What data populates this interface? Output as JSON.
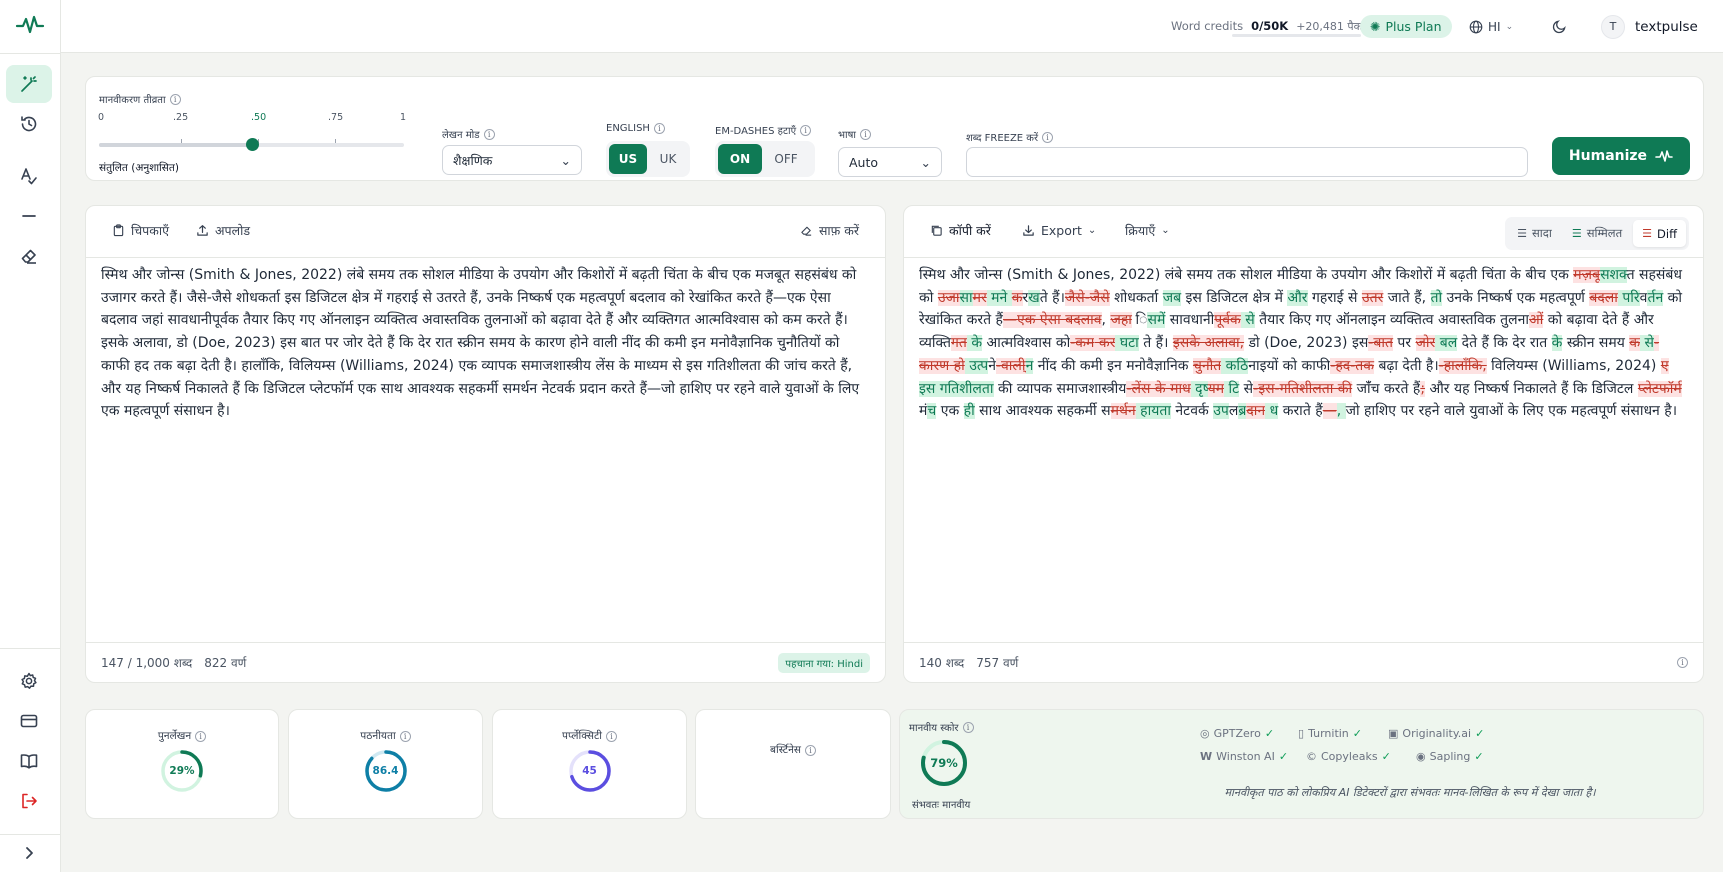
{
  "topbar": {
    "credits_label": "Word credits",
    "credits_value": "0/50K",
    "credits_bonus": "+20,481 पैक",
    "plan": "Plus Plan",
    "lang": "HI",
    "username": "textpulse",
    "avatar_initial": "T"
  },
  "settings": {
    "intensity_label": "मानवीकरण तीव्रता",
    "ticks": [
      "0",
      ".25",
      ".50",
      ".75",
      "1"
    ],
    "intensity_value": 0.5,
    "intensity_mode": "संतुलित (अनुशासित)",
    "mode_label": "लेखन मोड",
    "mode_value": "शैक्षणिक",
    "english_label": "ENGLISH",
    "english_options": [
      "US",
      "UK"
    ],
    "emdash_label": "EM-DASHES हटाएँ",
    "emdash_options": [
      "ON",
      "OFF"
    ],
    "language_label": "भाषा",
    "language_value": "Auto",
    "freeze_label": "शब्द FREEZE करें",
    "freeze_value": "",
    "humanize": "Humanize"
  },
  "input_panel": {
    "paste": "चिपकाएँ",
    "upload": "अपलोड",
    "clear": "साफ़ करें",
    "text": "स्मिथ और जोन्स (Smith & Jones, 2022) लंबे समय तक सोशल मीडिया के उपयोग और किशोरों में बढ़ती चिंता के बीच एक मजबूत सहसंबंध को उजागर करते हैं। जैसे-जैसे शोधकर्ता इस डिजिटल क्षेत्र में गहराई से उतरते हैं, उनके निष्कर्ष एक महत्वपूर्ण बदलाव को रेखांकित करते हैं—एक ऐसा बदलाव जहां सावधानीपूर्वक तैयार किए गए ऑनलाइन व्यक्तित्व अवास्तविक तुलनाओं को बढ़ावा देते हैं और व्यक्तिगत आत्मविश्वास को कम करते हैं। इसके अलावा, डो (Doe, 2023) इस बात पर जोर देते हैं कि देर रात स्क्रीन समय के कारण होने वाली नींद की कमी इन मनोवैज्ञानिक चुनौतियों को काफी हद तक बढ़ा देती है। हालाँकि, विलियम्स (Williams, 2024) एक व्यापक समाजशास्त्रीय लेंस के माध्यम से इस गतिशीलता की जांच करते हैं, और यह निष्कर्ष निकालते हैं कि डिजिटल प्लेटफॉर्म एक साथ आवश्यक सहकर्मी समर्थन नेटवर्क प्रदान करते हैं—जो हाशिए पर रहने वाले युवाओं के लिए एक महत्वपूर्ण संसाधन है।",
    "word_count": "147 / 1,000 शब्द",
    "char_count": "822 वर्ण",
    "detected": "पहचाना गया: Hindi"
  },
  "output_panel": {
    "copy": "कॉपी करें",
    "export": "Export",
    "actions": "क्रियाएँ",
    "views": [
      "सादा",
      "सम्मिलत",
      "Diff"
    ],
    "diff": [
      [
        "स्मिथ और जोन्स (Smith & Jones, 2022) लंबे समय तक सोशल मीडिया के उपयोग और किशोरों में बढ़ती चिंता के बीच एक ",
        "n"
      ],
      [
        "मज़बू",
        "d"
      ],
      [
        "सशक्",
        "i"
      ],
      [
        "त सहसंबंध को ",
        "n"
      ],
      [
        "उजा",
        "d"
      ],
      [
        "स",
        "i"
      ],
      [
        "ा",
        "n"
      ],
      [
        "मर",
        "d"
      ],
      [
        " मने ",
        "i"
      ],
      [
        "क",
        "d"
      ],
      [
        "र",
        "n"
      ],
      [
        "ख",
        "i"
      ],
      [
        "ते हैं।",
        "n"
      ],
      [
        "जैसे-जैसे",
        "d"
      ],
      [
        " शोधकर्ता ",
        "n"
      ],
      [
        "जब",
        "i"
      ],
      [
        " इस डिजिटल क्षेत्र में ",
        "n"
      ],
      [
        "और",
        "i"
      ],
      [
        " गहराई से ",
        "n"
      ],
      [
        "उतर",
        "d"
      ],
      [
        " जा",
        "n"
      ],
      [
        "ते हैं, ",
        "n"
      ],
      [
        "तो",
        "i"
      ],
      [
        " उनके निष्कर्ष एक महत्वपूर्ण ",
        "n"
      ],
      [
        "बदला",
        "d"
      ],
      [
        " परि",
        "i"
      ],
      [
        "व",
        "n"
      ],
      [
        "र्तन",
        "i"
      ],
      [
        " को रेखांकित करते हैं",
        "n"
      ],
      [
        "—एक ऐसा बदलाव",
        "d"
      ],
      [
        ", ",
        "n"
      ],
      [
        "जहा",
        "d"
      ],
      [
        " ",
        "n"
      ],
      [
        "ि",
        "n"
      ],
      [
        "समे",
        "i"
      ],
      [
        "ं सावधानी",
        "n"
      ],
      [
        "पूर्वक",
        "d"
      ],
      [
        " से",
        "i"
      ],
      [
        " तैयार किए गए ऑनलाइन व्यक्तित्व अवास्तविक तुलना",
        "n"
      ],
      [
        "ओं",
        "d"
      ],
      [
        " को बढ़ावा देते हैं और व्यक्ति",
        "n"
      ],
      [
        "गत",
        "d"
      ],
      [
        " के",
        "i"
      ],
      [
        " आत्मविश्वास को",
        "n"
      ],
      [
        "-कम",
        "d"
      ],
      [
        " कर",
        "d"
      ],
      [
        " घटा",
        "i"
      ],
      [
        " ते हैं। ",
        "n"
      ],
      [
        "इसके अलावा,",
        "d"
      ],
      [
        " डो (Doe, 2023) इस",
        "n"
      ],
      [
        "-बात",
        "d"
      ],
      [
        " पर ",
        "n"
      ],
      [
        "जोर",
        "d"
      ],
      [
        " बल",
        "i"
      ],
      [
        " देते हैं कि देर रात ",
        "n"
      ],
      [
        "के",
        "i"
      ],
      [
        " स्क्रीन समय ",
        "n"
      ],
      [
        "क",
        "d"
      ],
      [
        " स",
        "i"
      ],
      [
        "े",
        "n"
      ],
      [
        "-कारण",
        "d"
      ],
      [
        " हो",
        "d"
      ],
      [
        " उत्प",
        "i"
      ],
      [
        "न",
        "n"
      ],
      [
        "े-वाली",
        "d"
      ],
      [
        "्न",
        "i"
      ],
      [
        " नींद की कमी इन मनोवैज्ञानिक ",
        "n"
      ],
      [
        "चुनौत",
        "d"
      ],
      [
        " कठ",
        "i"
      ],
      [
        "िनाइ",
        "n"
      ],
      [
        "यों को काफी",
        "n"
      ],
      [
        "-हद-तक",
        "d"
      ],
      [
        " बढ़ा देती है।",
        "n"
      ],
      [
        "-हालाँकि,",
        "d"
      ],
      [
        " विलियम्स (Williams, 2024) ",
        "n"
      ],
      [
        "ए",
        "d"
      ],
      [
        " इस गतिशीलता",
        "i"
      ],
      [
        " क",
        "n"
      ],
      [
        "ी",
        "i"
      ],
      [
        " व्यापक समाजशास्त्रीय",
        "n"
      ],
      [
        "-लेंस के",
        "d"
      ],
      [
        " माध",
        "d"
      ],
      [
        " दृष",
        "i"
      ],
      [
        "्",
        "n"
      ],
      [
        "यम",
        "d"
      ],
      [
        " टि",
        "i"
      ],
      [
        " से",
        "n"
      ],
      [
        "-इस-गतिशीलता की",
        "d"
      ],
      [
        " जा",
        "n"
      ],
      [
        "ं",
        "n"
      ],
      [
        "ँ",
        "i"
      ],
      [
        "च करते हैं",
        "n"
      ],
      [
        ";",
        "d"
      ],
      [
        " और यह निष्कर्ष निकालते हैं कि डिजिटल ",
        "n"
      ],
      [
        "प्लेटफॉर्म",
        "d"
      ],
      [
        " म",
        "n"
      ],
      [
        "ंच",
        "i"
      ],
      [
        " एक ",
        "n"
      ],
      [
        "ही",
        "i"
      ],
      [
        " साथ आवश्यक सहकर्मी स",
        "n"
      ],
      [
        "मर्थन",
        "d"
      ],
      [
        " हायता",
        "i"
      ],
      [
        " नेटवर्क ",
        "n"
      ],
      [
        "उप",
        "i"
      ],
      [
        "ल",
        "n"
      ],
      [
        "ब",
        "i"
      ],
      [
        "्",
        "n"
      ],
      [
        "रदान",
        "d"
      ],
      [
        " ध",
        "i"
      ],
      [
        " कर",
        "n"
      ],
      [
        "ा",
        "i"
      ],
      [
        "ते हैं",
        "n"
      ],
      [
        "—",
        "d"
      ],
      [
        ", ",
        "i"
      ],
      [
        "जो हाशिए पर रहने वाले युवाओं के लिए एक महत्वपूर्ण संसाधन है।",
        "n"
      ]
    ],
    "word_count": "140 शब्द",
    "char_count": "757 वर्ण"
  },
  "metrics": {
    "rewrite_label": "पुनर्लेखन",
    "rewrite_value": "29%",
    "rewrite_pct": 29,
    "readability_label": "पठनीयता",
    "readability_value": "86.4",
    "readability_pct": 86.4,
    "perplexity_label": "पर्प्लेक्सिटी",
    "perplexity_value": "45",
    "perplexity_pct": 70,
    "burstiness_label": "बर्स्टिनेस",
    "score_label": "मानवीय स्कोर",
    "score_value": "79%",
    "score_pct": 79,
    "score_caption": "संभवतः मानवीय",
    "detectors": [
      "GPTZero",
      "Turnitin",
      "Originality.ai",
      "Winston AI",
      "Copyleaks",
      "Sapling"
    ],
    "detector_note": "मानवीकृत पाठ को लोकप्रिय AI डिटेक्टरों द्वारा संभवतः मानव-लिखित के रूप में देखा जाता है।"
  },
  "colors": {
    "accent": "#0f7a55",
    "insert_bg": "#d1f3e0",
    "delete_bg": "#fde2e2"
  }
}
